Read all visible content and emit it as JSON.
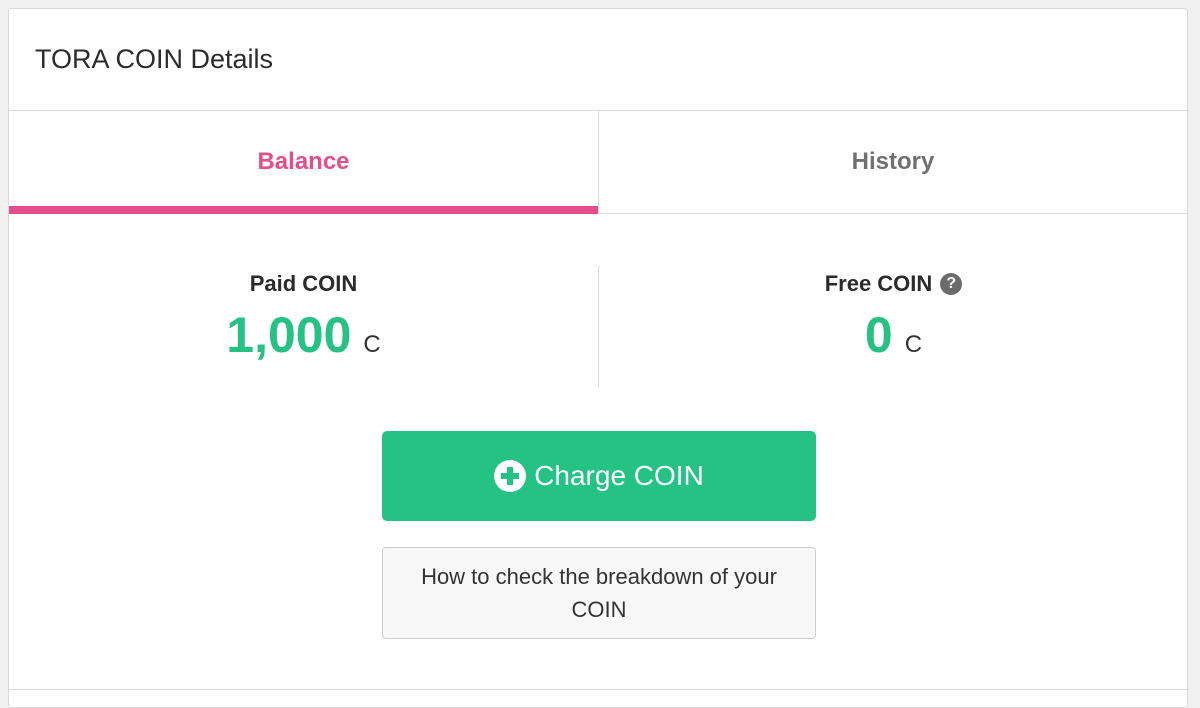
{
  "header": {
    "title": "TORA COIN Details"
  },
  "tabs": [
    {
      "label": "Balance",
      "active": true
    },
    {
      "label": "History",
      "active": false
    }
  ],
  "balances": {
    "paid": {
      "label": "Paid COIN",
      "value": "1,000",
      "unit": "C"
    },
    "free": {
      "label": "Free COIN",
      "value": "0",
      "unit": "C",
      "help_icon": "?"
    }
  },
  "actions": {
    "charge_label": "Charge COIN",
    "breakdown_label": "How to check the breakdown of your COIN"
  },
  "colors": {
    "accent_pink": "#e44f8b",
    "accent_green": "#25c286"
  }
}
